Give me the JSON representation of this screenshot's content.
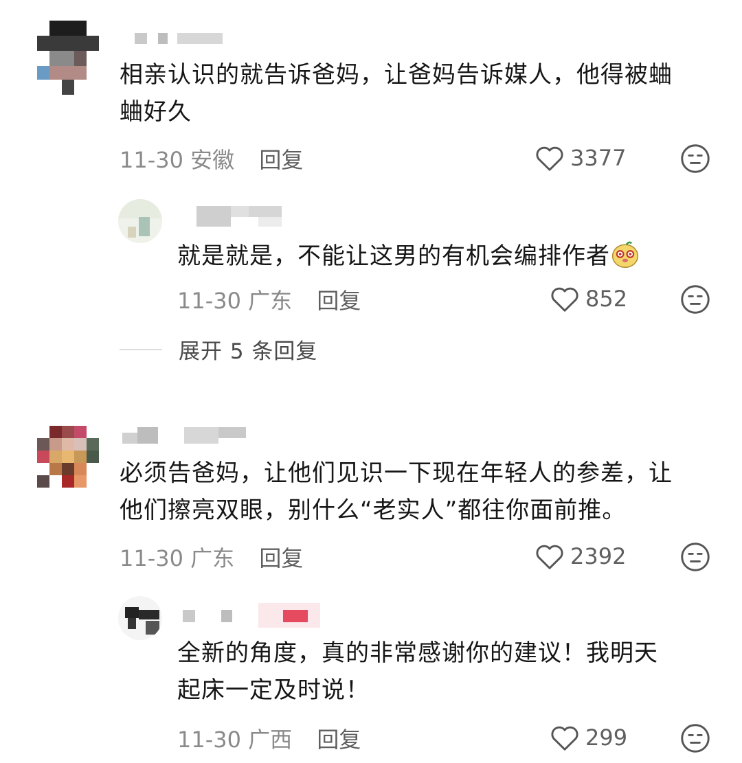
{
  "comments": [
    {
      "text_lines": [
        "相亲认识的就告诉爸妈，让爸妈告诉媒人，他得被蛐",
        "蛐好久"
      ],
      "date": "11-30",
      "region": "安徽",
      "reply_label": "回复",
      "likes": "3377"
    },
    {
      "text_lines": [
        "就是就是，不能让这男的有机会编排作者"
      ],
      "date": "11-30",
      "region": "广东",
      "reply_label": "回复",
      "likes": "852",
      "expand_label": "展开 5 条回复"
    },
    {
      "text_lines": [
        "必须告爸妈，让他们见识一下现在年轻人的参差，让",
        "他们擦亮双眼，别什么“老实人”都往你面前推。"
      ],
      "date": "11-30",
      "region": "广东",
      "reply_label": "回复",
      "likes": "2392"
    },
    {
      "text_lines": [
        "全新的角度，真的非常感谢你的建议！我明天",
        "起床一定及时说！"
      ],
      "date": "11-30",
      "region": "广西",
      "reply_label": "回复",
      "likes": "299"
    }
  ],
  "icons": {
    "like": "heart-outline-icon",
    "dislike": "unamused-face-icon",
    "emoji": "cartoon-face-emoji"
  },
  "colors": {
    "text": "#161616",
    "meta": "#8a8a8a",
    "reply": "#5f5f5f",
    "icon": "#555555"
  }
}
